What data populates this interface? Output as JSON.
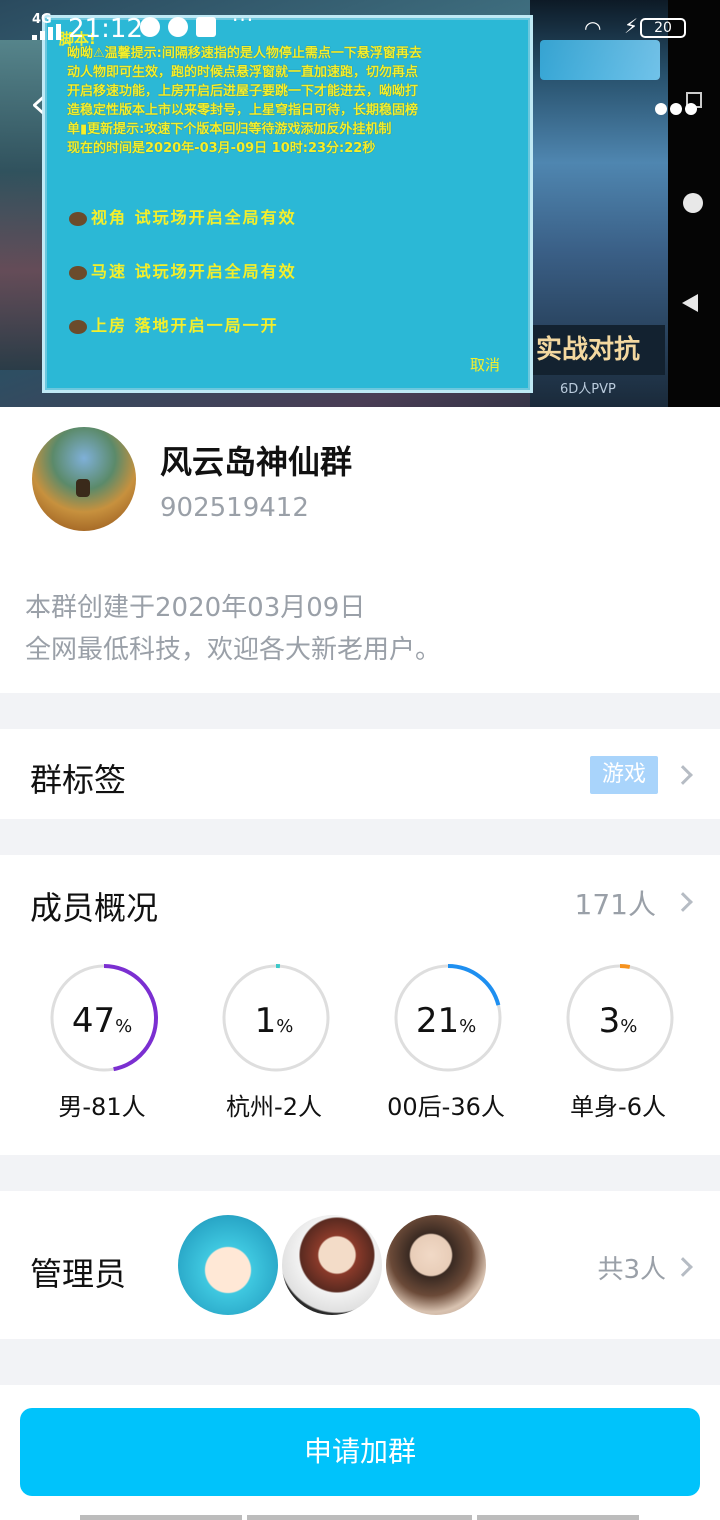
{
  "status_bar": {
    "time": "21:12",
    "network": "4G",
    "more": "···",
    "battery": "20"
  },
  "cover": {
    "popup_header": "脚本!",
    "notice_lines": [
      "呦呦⚠温馨提示:间隔移速指的是人物停止需点一下悬浮窗再去",
      "动人物即可生效，跑的时候点悬浮窗就一直加速跑，切勿再点",
      "开启移速功能，上房开启后进屋子要跳一下才能进去，呦呦打",
      "造稳定性版本上市以来零封号，上星穹指日可待，长期稳固榜",
      "单▮更新提示:攻速下个版本回归等待游戏添加反外挂机制",
      "现在的时间是2020年-03月-09日 10时:23分:22秒"
    ],
    "options": [
      "视角 试玩场开启全局有效",
      "马速 试玩场开启全局有效",
      "上房 落地开启一局一开"
    ],
    "cancel": "取消",
    "side_badge": "实战对抗",
    "side_sub": "6D人PVP"
  },
  "group": {
    "name": "风云岛神仙群",
    "id": "902519412",
    "description": [
      "本群创建于2020年03月09日",
      "全网最低科技，欢迎各大新老用户。"
    ]
  },
  "tags": {
    "title": "群标签",
    "chip": "游戏"
  },
  "members": {
    "title": "成员概况",
    "count": "171人",
    "stats": [
      {
        "value": "47",
        "unit": "%",
        "label": "男-81人",
        "fraction": 0.47,
        "color": "#7b2fd1"
      },
      {
        "value": "1",
        "unit": "%",
        "label": "杭州-2人",
        "fraction": 0.01,
        "color": "#3cc8c8"
      },
      {
        "value": "21",
        "unit": "%",
        "label": "00后-36人",
        "fraction": 0.21,
        "color": "#1e8ff0"
      },
      {
        "value": "3",
        "unit": "%",
        "label": "单身-6人",
        "fraction": 0.03,
        "color": "#f5921e"
      }
    ]
  },
  "admins": {
    "title": "管理员",
    "count": "共3人"
  },
  "actions": {
    "apply": "申请加群"
  }
}
